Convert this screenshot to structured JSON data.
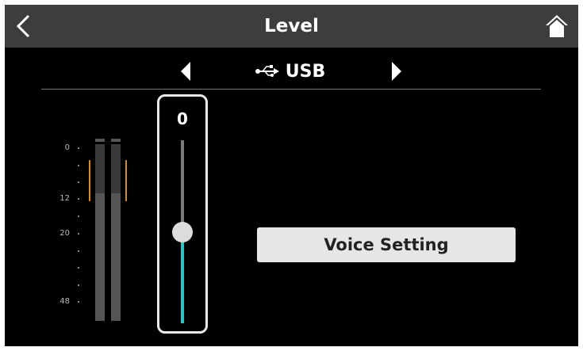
{
  "header": {
    "title": "Level",
    "back_icon": "chevron-left-icon",
    "home_icon": "home-icon"
  },
  "source": {
    "label": "USB",
    "icon": "usb-icon",
    "prev_icon": "triangle-left-icon",
    "next_icon": "triangle-right-icon"
  },
  "meter": {
    "scale": [
      "0",
      "12",
      "20",
      "48"
    ],
    "level_fraction": 0.72,
    "peak_color": "#e08a1e"
  },
  "fader": {
    "value": "0",
    "position_fraction": 0.5,
    "fill_color": "#1ec9c9"
  },
  "voice_setting": {
    "label": "Voice Setting"
  }
}
